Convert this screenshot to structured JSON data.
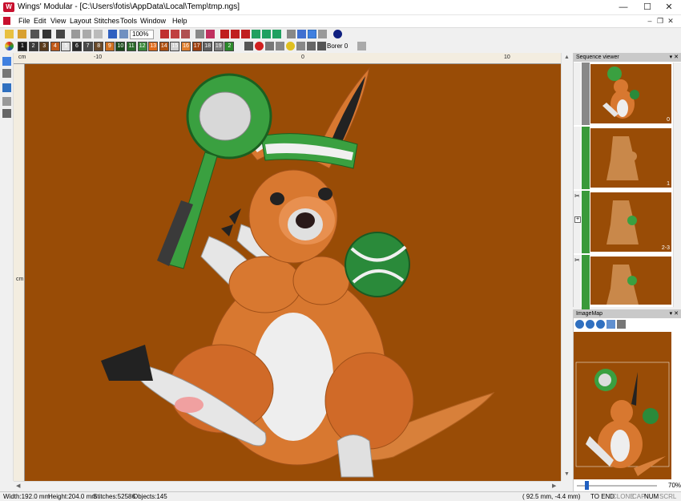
{
  "window": {
    "app_name": "Wings' Modular",
    "file_path": "[C:\\Users\\fotis\\AppData\\Local\\Temp\\tmp.ngs]",
    "minimize": "—",
    "maximize": "☐",
    "close": "✕"
  },
  "menu": [
    "File",
    "Edit",
    "View",
    "Layout",
    "Stitches",
    "Tools",
    "Window",
    "Help"
  ],
  "toolbar": {
    "zoom_value": "100%",
    "border_combo": "Borer 0",
    "color_numbers": [
      "1",
      "2",
      "3",
      "4",
      "5",
      "6",
      "7",
      "8",
      "9",
      "10",
      "11",
      "12",
      "13",
      "14",
      "15",
      "16",
      "17",
      "18",
      "19",
      "2"
    ]
  },
  "rulers": {
    "unit": "cm",
    "h_labels": [
      "-10",
      "0",
      "10"
    ],
    "v_label": "cm"
  },
  "sequence_viewer": {
    "title": "Sequence viewer",
    "items": [
      "0",
      "1",
      "2-3",
      ""
    ]
  },
  "imagemap": {
    "title": "ImageMap",
    "zoom": "70%"
  },
  "status": {
    "width": "Width:192.0 mm",
    "height": "Height:204.0 mm",
    "stitches": "Stitches:52586",
    "objects": "Objects:145",
    "coords": "(  92.5 mm,    -4.4 mm)",
    "to_end": "TO END",
    "clone": "CLONE",
    "cap": "CAP",
    "num": "NUM",
    "scrl": "SCRL"
  },
  "colors": {
    "canvas_bg": "#994c06",
    "swatches": [
      "#1a1a1a",
      "#3a3a3a",
      "#5a3a1a",
      "#c05a1a",
      "#e0e0e0",
      "#2a2a2a",
      "#4a4a4a",
      "#6a4a2a",
      "#d07020",
      "#1a4a1a",
      "#2a6a2a",
      "#3a8a3a",
      "#e06a1a",
      "#b05010",
      "#d0d0d0",
      "#e08030",
      "#a04010",
      "#606060",
      "#808080",
      "#2a8a2a"
    ]
  }
}
